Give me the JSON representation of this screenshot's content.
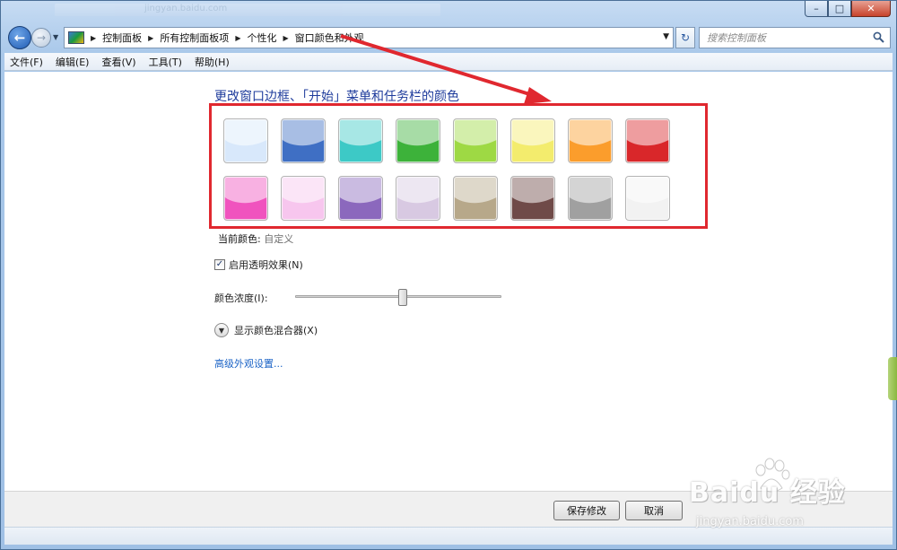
{
  "window": {
    "caption_ghost_text": "jingyan.baidu.com",
    "controls": {
      "minimize": "–",
      "maximize": "□",
      "close": "✕"
    }
  },
  "address_bar": {
    "breadcrumbs": [
      "控制面板",
      "所有控制面板项",
      "个性化",
      "窗口颜色和外观"
    ],
    "search_placeholder": "搜索控制面板"
  },
  "menu": [
    "文件(F)",
    "编辑(E)",
    "查看(V)",
    "工具(T)",
    "帮助(H)"
  ],
  "main": {
    "heading": "更改窗口边框、「开始」菜单和任务栏的颜色",
    "swatches": [
      {
        "name": "sky",
        "color": "#d8e8fb"
      },
      {
        "name": "twilight",
        "color": "#3f6fc4"
      },
      {
        "name": "sea",
        "color": "#3dc9c6"
      },
      {
        "name": "leaf",
        "color": "#3db23a"
      },
      {
        "name": "lime",
        "color": "#9ed944"
      },
      {
        "name": "sun",
        "color": "#f3ec6d"
      },
      {
        "name": "pumpkin",
        "color": "#fb9d2c"
      },
      {
        "name": "ruby",
        "color": "#d9272a"
      },
      {
        "name": "fuchsia",
        "color": "#f053be"
      },
      {
        "name": "blush",
        "color": "#f7c6ee"
      },
      {
        "name": "violet",
        "color": "#8b68bd"
      },
      {
        "name": "lavender",
        "color": "#d8c9e2"
      },
      {
        "name": "taupe",
        "color": "#b7a88a"
      },
      {
        "name": "chocolate",
        "color": "#6f4a48"
      },
      {
        "name": "slate",
        "color": "#a0a0a0"
      },
      {
        "name": "frost",
        "color": "#f2f2f2"
      }
    ],
    "current_color_label": "当前颜色:",
    "current_color_value": "自定义",
    "transparency_label": "启用透明效果(N)",
    "transparency_checked": true,
    "intensity_label": "颜色浓度(I):",
    "intensity_level": 0.52,
    "mixer_label": "显示颜色混合器(X)",
    "advanced_link": "高级外观设置..."
  },
  "footer": {
    "save_label": "保存修改",
    "cancel_label": "取消"
  },
  "watermark": {
    "brand": "Baidu 经验",
    "url": "jingyan.baidu.com"
  },
  "colors": {
    "annotation": "#e0282f",
    "heading": "#1f3c9c",
    "link": "#1b63c6"
  }
}
